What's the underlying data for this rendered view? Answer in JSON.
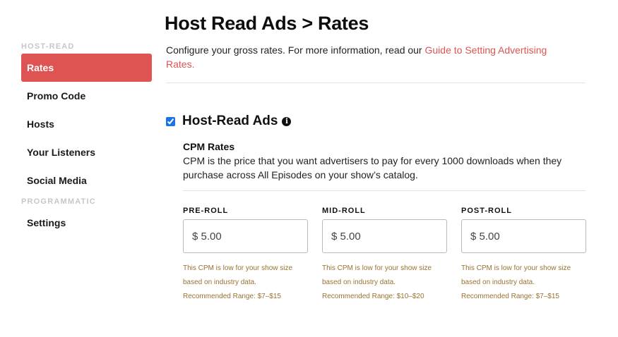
{
  "sidebar": {
    "sections": [
      {
        "label": "HOST-READ",
        "items": [
          "Rates",
          "Promo Code",
          "Hosts",
          "Your Listeners",
          "Social Media"
        ]
      },
      {
        "label": "PROGRAMMATIC",
        "items": [
          "Settings"
        ]
      }
    ],
    "active_item": "Rates"
  },
  "main": {
    "title": "Host Read Ads > Rates",
    "intro_text": "Configure your gross rates. For more information, read our ",
    "intro_link": "Guide to Setting Advertising Rates.",
    "ads_section": {
      "checked": true,
      "title": "Host-Read Ads",
      "info_icon": "i",
      "cpm_title": "CPM Rates",
      "cpm_desc": "CPM is the price that you want advertisers to pay for every 1000 downloads when they purchase across All Episodes on your show’s catalog.",
      "fields": [
        {
          "label": "PRE-ROLL",
          "value": "$ 5.00",
          "hint_line1": "This CPM is low for your show size",
          "hint_line2": "based on industry data.",
          "hint_line3": "Recommended Range: $7–$15"
        },
        {
          "label": "MID-ROLL",
          "value": "$ 5.00",
          "hint_line1": "This CPM is low for your show size",
          "hint_line2": "based on industry data.",
          "hint_line3": "Recommended Range: $10–$20"
        },
        {
          "label": "POST-ROLL",
          "value": "$ 5.00",
          "hint_line1": "This CPM is low for your show size",
          "hint_line2": "based on industry data.",
          "hint_line3": "Recommended Range: $7–$15"
        }
      ]
    }
  },
  "colors": {
    "accent": "#dd5452",
    "hint": "#9a7232",
    "section_label": "#c7c7c7"
  }
}
